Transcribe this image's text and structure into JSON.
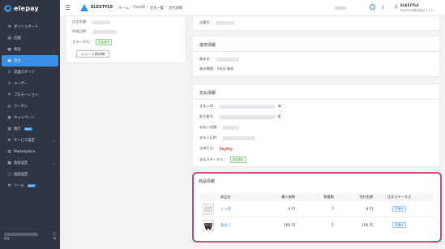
{
  "app": {
    "brand": "elepay"
  },
  "sidebar": {
    "items": [
      {
        "label": "ダッシュボード",
        "icon": "dashboard-icon",
        "glyph": "◔"
      },
      {
        "label": "店舗",
        "icon": "store-icon",
        "glyph": "▤"
      },
      {
        "label": "商品",
        "icon": "product-icon",
        "glyph": "▦",
        "chevron": "⌄"
      },
      {
        "label": "注文",
        "icon": "order-icon",
        "glyph": "▣",
        "active": true
      },
      {
        "label": "店舗スタッフ",
        "icon": "staff-icon",
        "glyph": "♙"
      },
      {
        "label": "ユーザー",
        "icon": "user-icon",
        "glyph": "♙"
      },
      {
        "label": "プロモーション",
        "icon": "promotion-icon",
        "glyph": "✎"
      },
      {
        "label": "クーポン",
        "icon": "coupon-icon",
        "glyph": "◎"
      },
      {
        "label": "キャンペーン",
        "icon": "campaign-icon",
        "glyph": "◉"
      },
      {
        "label": "統計",
        "icon": "stats-icon",
        "glyph": "▥",
        "badge": "Beta"
      },
      {
        "label": "サービス設定",
        "icon": "service-settings-icon",
        "glyph": "⚙",
        "chevron": "⌄"
      },
      {
        "label": "Marketplace",
        "icon": "marketplace-icon",
        "glyph": "▤"
      },
      {
        "label": "商材設定",
        "icon": "merchandise-settings-icon",
        "glyph": "▦",
        "chevron": "⌄"
      },
      {
        "label": "画面設定",
        "icon": "screen-settings-icon",
        "glyph": "▢"
      },
      {
        "label": "ツール",
        "icon": "tool-icon",
        "glyph": "⚒",
        "badge": "Beta"
      }
    ],
    "footer": {
      "label": "設定",
      "icon_glyph": "⇲"
    }
  },
  "header": {
    "menu_glyph": "☰",
    "store_name": "ELESTYLE",
    "breadcrumb": [
      "ホーム",
      "OneQR",
      "注文一覧",
      "注文詳細"
    ],
    "help_glyph": "?",
    "download_glyph": "⤓",
    "user_glyph": "♙",
    "user_name": "ELESTYLE",
    "user_sub": "ELESTYLE株式会社(テスト)"
  },
  "order_card": {
    "fields": [
      {
        "label": "注文金額："
      },
      {
        "label": "作成日時："
      },
      {
        "label": "ステータス：",
        "badge": "支払済み"
      }
    ],
    "receipt_button": "レシート再印刷"
  },
  "top_right_card": {
    "field_label": "店番号："
  },
  "terminal_card": {
    "title": "端末情報",
    "fields": [
      {
        "label": "端末名："
      },
      {
        "label": "端末種類：",
        "value": "Shop 端末"
      }
    ]
  },
  "payment_card": {
    "title": "支払情報",
    "fields": [
      {
        "label": "支払いID："
      },
      {
        "label": "取引番号："
      },
      {
        "label": "支払い金額："
      },
      {
        "label": "支払い日時："
      },
      {
        "label": "決済方法：",
        "method": "PayPay"
      },
      {
        "label": "支払ステータス：",
        "badge": "支払済み"
      }
    ],
    "copy_glyph": "⧉"
  },
  "product_card": {
    "title": "商品情報",
    "headers": [
      "商品名",
      "購入価格",
      "数量数",
      "合計金額",
      "注文ステータス"
    ],
    "rows": [
      {
        "name": "レジ袋",
        "price": "4 円",
        "qty": "1",
        "total": "4 円",
        "status": "準備中"
      },
      {
        "name": "商品 C",
        "price": "100 円",
        "qty": "1",
        "total": "100 円",
        "status": "準備中"
      }
    ]
  },
  "colors": {
    "accent": "#3a8ee6",
    "highlight": "#e0407a",
    "sidebar": "#2f3542"
  }
}
